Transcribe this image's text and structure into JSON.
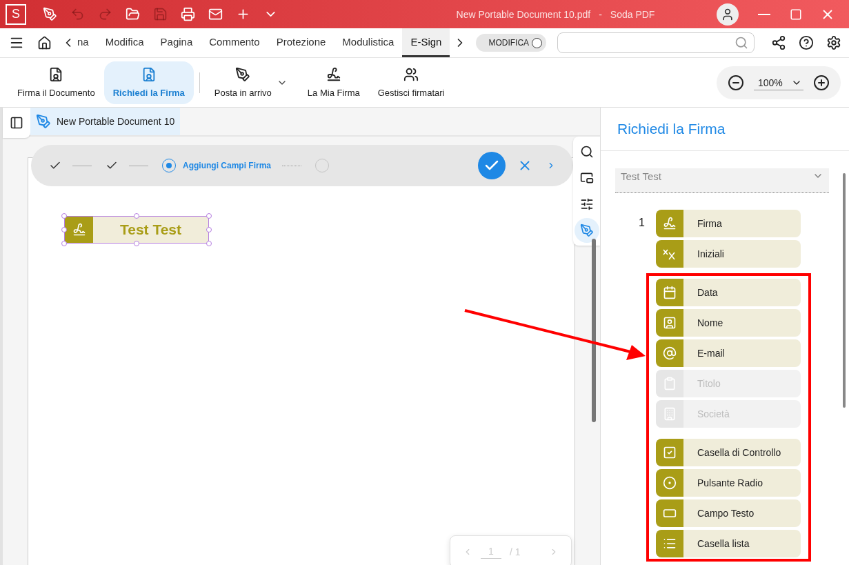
{
  "window": {
    "logo": "S",
    "document": "New Portable Document 10.pdf",
    "separator": "-",
    "app": "Soda PDF"
  },
  "quick_access": [
    {
      "disabled": false
    },
    {
      "disabled": true
    },
    {
      "disabled": true
    },
    {
      "disabled": false
    },
    {
      "disabled": true
    },
    {
      "disabled": false
    },
    {
      "disabled": false
    },
    {
      "disabled": false
    },
    {
      "disabled": false
    }
  ],
  "menu": {
    "tabs": [
      {
        "label": "na",
        "selected": false
      },
      {
        "label": "Modifica",
        "selected": false
      },
      {
        "label": "Pagina",
        "selected": false
      },
      {
        "label": "Commento",
        "selected": false
      },
      {
        "label": "Protezione",
        "selected": false
      },
      {
        "label": "Modulistica",
        "selected": false
      },
      {
        "label": "E-Sign",
        "selected": true
      }
    ],
    "mode_toggle": {
      "label": "MODIFICA",
      "on": false
    }
  },
  "toolbar": {
    "items": [
      {
        "label": "Firma il Documento",
        "selected": false,
        "dropdown": false
      },
      {
        "label": "Richiedi la Firma",
        "selected": true,
        "dropdown": false
      },
      {
        "label": "Posta in arrivo",
        "selected": false,
        "dropdown": true
      },
      {
        "label": "La Mia Firma",
        "selected": false,
        "dropdown": false
      },
      {
        "label": "Gestisci firmatari",
        "selected": false,
        "dropdown": false
      }
    ],
    "zoom": "100%"
  },
  "document_tab": {
    "title": "New Portable Document 10"
  },
  "steps": [
    {
      "done": true,
      "current": false
    },
    {
      "done": true,
      "current": false
    },
    {
      "done": false,
      "current": true,
      "label": "Aggiungi Campi Firma"
    },
    {
      "done": false,
      "current": false
    }
  ],
  "page": {
    "signature_field": {
      "text": "Test Test",
      "selected": true
    }
  },
  "pager": {
    "current": "1",
    "total": "/ 1"
  },
  "side_tools": [
    {
      "selected": false
    },
    {
      "selected": false
    },
    {
      "selected": false
    },
    {
      "selected": true
    }
  ],
  "panel": {
    "title": "Richiedi la Firma",
    "signer": "Test Test",
    "signer_number": "1",
    "signature_fields": [
      {
        "label": "Firma",
        "disabled": false
      },
      {
        "label": "Iniziali",
        "disabled": false
      }
    ],
    "info_fields": [
      {
        "label": "Data",
        "disabled": false
      },
      {
        "label": "Nome",
        "disabled": false
      },
      {
        "label": "E-mail",
        "disabled": false
      },
      {
        "label": "Titolo",
        "disabled": true
      },
      {
        "label": "Società",
        "disabled": true
      }
    ],
    "form_fields": [
      {
        "label": "Casella di Controllo",
        "disabled": false
      },
      {
        "label": "Pulsante Radio",
        "disabled": false
      },
      {
        "label": "Campo Testo",
        "disabled": false
      },
      {
        "label": "Casella lista",
        "disabled": false
      }
    ]
  }
}
